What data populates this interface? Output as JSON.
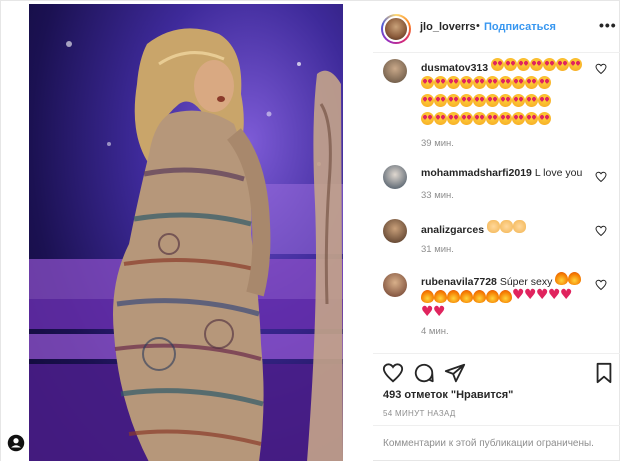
{
  "header": {
    "username": "jlo_loverrs",
    "separator": "•",
    "follow_label": "Подписаться",
    "more_label": "•••"
  },
  "comments": [
    {
      "username": "dusmatov313",
      "text": "",
      "emoji_rows": [
        [
          "love",
          "love",
          "love",
          "love",
          "love",
          "love",
          "love"
        ],
        [
          "love",
          "love",
          "love",
          "love",
          "love",
          "love",
          "love",
          "love",
          "love",
          "love"
        ],
        [
          "love",
          "love",
          "love",
          "love",
          "love",
          "love",
          "love",
          "love",
          "love",
          "love"
        ],
        [
          "love",
          "love",
          "love",
          "love",
          "love",
          "love",
          "love",
          "love",
          "love",
          "love"
        ]
      ],
      "time": "39 мин."
    },
    {
      "username": "mohammadsharfi2019",
      "text": "L love you",
      "time": "33 мин."
    },
    {
      "username": "analizgarces",
      "text": "",
      "emoji": [
        "clap",
        "clap",
        "clap"
      ],
      "time": "31 мин."
    },
    {
      "username": "rubenavila7728",
      "text": "Súper sexy",
      "time": "4 мин."
    }
  ],
  "actions": {
    "likes": "493 отметок \"Нравится\"",
    "posted": "54 МИНУТ НАЗАД"
  },
  "comments_restricted": "Комментарии к этой публикации ограничены."
}
